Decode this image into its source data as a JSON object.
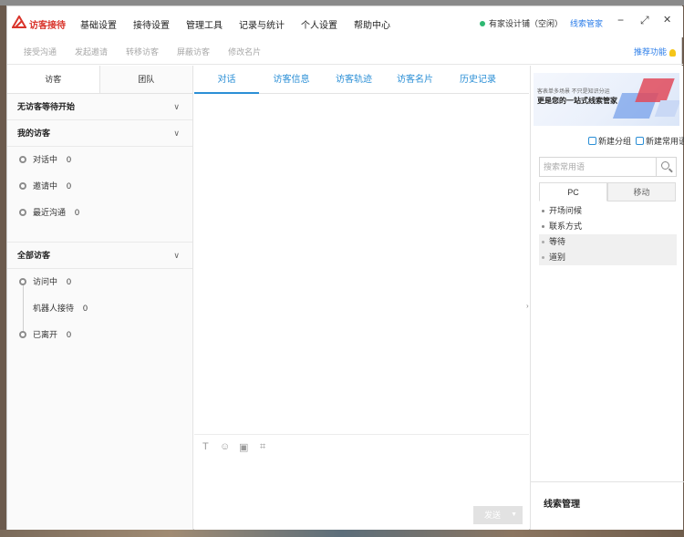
{
  "app": {
    "name": "访客接待"
  },
  "menu": [
    "基础设置",
    "接待设置",
    "管理工具",
    "记录与统计",
    "个人设置",
    "帮助中心"
  ],
  "status": {
    "account": "有家设计铺（空闲）",
    "leads_link": "线索管家",
    "status_color": "#2eb872"
  },
  "window_controls": {
    "minimize": "−",
    "maximize": "⤢",
    "close": "✕"
  },
  "toolbar": {
    "actions": [
      "接受沟通",
      "发起邀请",
      "转移访客",
      "屏蔽访客",
      "修改名片"
    ],
    "recommend": "推荐功能"
  },
  "left": {
    "tabs": [
      "访客",
      "团队"
    ],
    "waiting": "无访客等待开始",
    "my_visitors": {
      "title": "我的访客",
      "items": [
        {
          "label": "对话中",
          "count": "0"
        },
        {
          "label": "邀请中",
          "count": "0"
        },
        {
          "label": "最近沟通",
          "count": "0"
        }
      ]
    },
    "all_visitors": {
      "title": "全部访客",
      "items": [
        {
          "label": "访问中",
          "count": "0"
        },
        {
          "label": "机器人接待",
          "count": "0"
        },
        {
          "label": "已离开",
          "count": "0"
        }
      ]
    }
  },
  "center": {
    "tabs": [
      "对话",
      "访客信息",
      "访客轨迹",
      "访客名片",
      "历史记录"
    ],
    "tools": [
      "T",
      "☺",
      "▣",
      "⌗"
    ],
    "send": "发送"
  },
  "right": {
    "banner_small": "客表单多场景 不只是知识分运",
    "banner_title": "更是您的一站式线索管家",
    "quick_actions": [
      "新建分组",
      "新建常用语"
    ],
    "search_placeholder": "搜索常用语",
    "tabs": [
      "PC",
      "移动"
    ],
    "phrases": [
      {
        "label": "开场问候",
        "group": false
      },
      {
        "label": "联系方式",
        "group": false
      },
      {
        "label": "等待",
        "group": true
      },
      {
        "label": "道别",
        "group": true
      }
    ],
    "leads_management": "线索管理"
  },
  "colors": {
    "brand": "#d9342b",
    "accent": "#2b8fd6",
    "link": "#2b7de9"
  }
}
